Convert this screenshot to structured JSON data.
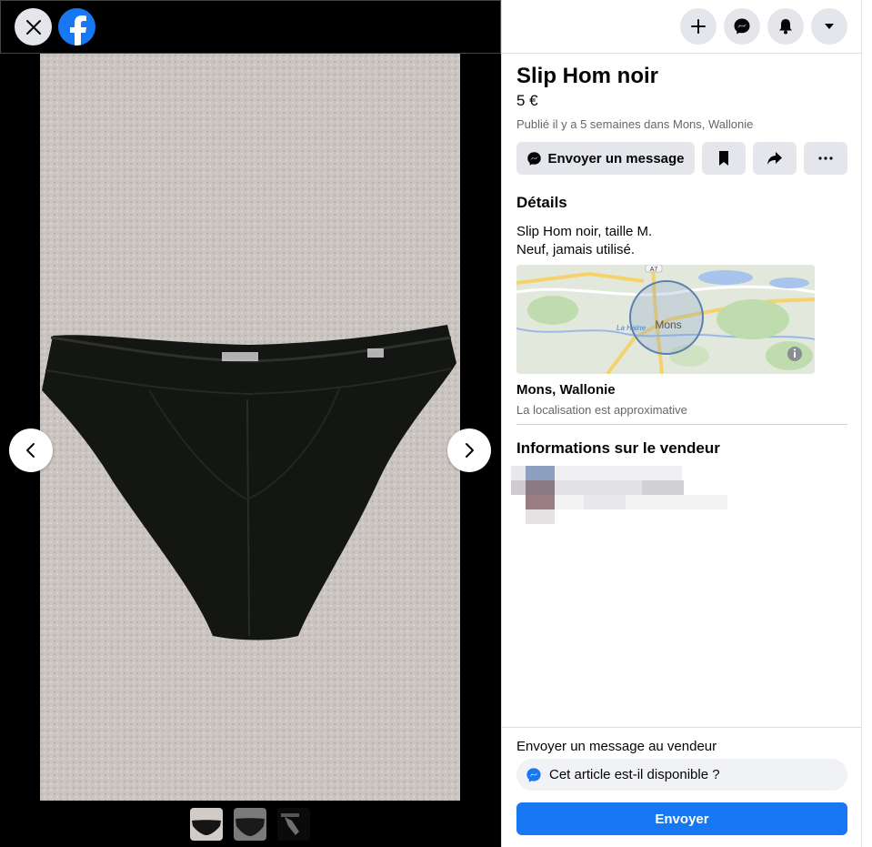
{
  "listing": {
    "title": "Slip Hom noir",
    "price": "5 €",
    "published": "Publié il y a 5 semaines dans Mons, Wallonie",
    "actions": {
      "message_label": "Envoyer un message"
    },
    "details_heading": "Détails",
    "description_line1": "Slip Hom noir, taille M.",
    "description_line2": "Neuf, jamais utilisé.",
    "map": {
      "city_label": "Mons",
      "river_label": "La Haine",
      "road_label": "A7"
    },
    "location_name": "Mons, Wallonie",
    "location_note": "La localisation est approximative",
    "seller_heading": "Informations sur le vendeur"
  },
  "compose": {
    "label": "Envoyer un message au vendeur",
    "input_value": "Cet article est-il disponible ?",
    "send_label": "Envoyer"
  },
  "icons": {
    "close": "close-icon",
    "logo": "facebook-logo",
    "create": "plus-icon",
    "messenger": "messenger-icon",
    "notifications": "bell-icon",
    "account": "caret-down-icon",
    "save": "bookmark-icon",
    "share": "share-icon",
    "more": "more-icon",
    "prev": "chevron-left-icon",
    "next": "chevron-right-icon",
    "info": "info-icon"
  },
  "colors": {
    "brand": "#1877f2",
    "button_bg": "#e4e6eb",
    "secondary_text": "#65676b",
    "photo_bg": "#cbc5c2",
    "garment": "#141614"
  }
}
